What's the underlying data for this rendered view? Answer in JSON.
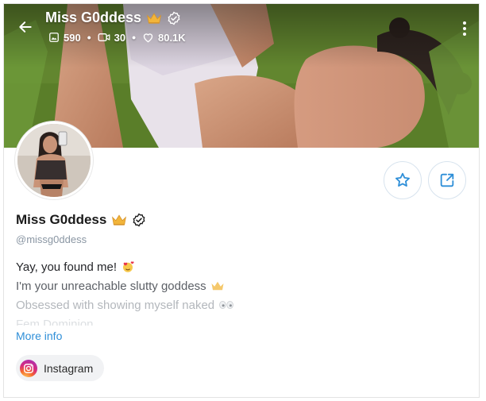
{
  "cover": {
    "title": "Miss G0ddess",
    "stats": {
      "photos": "590",
      "videos": "30",
      "likes": "80.1K"
    }
  },
  "profile": {
    "name": "Miss G0ddess",
    "handle": "@missg0ddess",
    "bio_lines": [
      "Yay, you found me!",
      "I'm your unreachable slutty goddess",
      "Obsessed with showing myself naked",
      "Fem Dominion"
    ],
    "more_info_label": "More info",
    "social": {
      "instagram_label": "Instagram"
    }
  },
  "colors": {
    "accent": "#2f8fd8",
    "crown": "#f2b53a",
    "muted_text": "#8a96a3",
    "button_border": "#d7e3ee"
  },
  "icons": {
    "back": "arrow-left-icon",
    "crown": "crown-icon",
    "verified": "verified-badge-icon",
    "photos": "image-icon",
    "videos": "video-icon",
    "likes": "heart-icon",
    "more": "more-vertical-icon",
    "favorite": "star-icon",
    "share": "share-icon",
    "instagram": "instagram-icon"
  }
}
